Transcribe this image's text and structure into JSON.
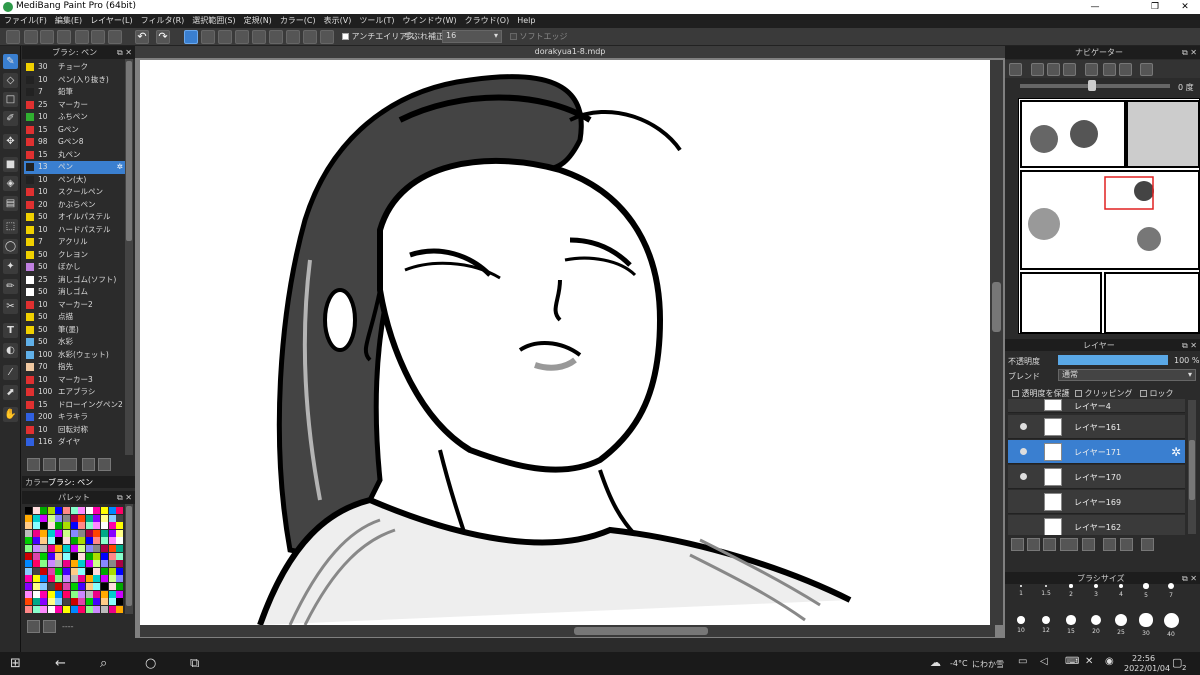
{
  "window": {
    "title": "MediBang Paint Pro (64bit)",
    "minimize": "—",
    "maximize": "❐",
    "close": "✕"
  },
  "menu": [
    "ファイル(F)",
    "編集(E)",
    "レイヤー(L)",
    "フィルタ(R)",
    "選択範囲(S)",
    "定規(N)",
    "カラー(C)",
    "表示(V)",
    "ツール(T)",
    "ウインドウ(W)",
    "クラウド(O)",
    "Help"
  ],
  "toolbar": {
    "antialias_label": "アンチエイリアス",
    "stabilizer_label": "手ぶれ補正",
    "stabilizer_value": "16",
    "soft_edge_label": "ソフトエッジ"
  },
  "brush_panel": {
    "title": "ブラシ: ペン",
    "items": [
      {
        "size": "30",
        "name": "チョーク",
        "color": "#f0d000"
      },
      {
        "size": "10",
        "name": "ペン(入り抜き)",
        "color": "#222222"
      },
      {
        "size": "7",
        "name": "鉛筆",
        "color": "#222222"
      },
      {
        "size": "25",
        "name": "マーカー",
        "color": "#e03030"
      },
      {
        "size": "10",
        "name": "ふちペン",
        "color": "#30b030"
      },
      {
        "size": "15",
        "name": "Gペン",
        "color": "#e03030"
      },
      {
        "size": "98",
        "name": "Gペン8",
        "color": "#e03030"
      },
      {
        "size": "15",
        "name": "丸ペン",
        "color": "#e03030"
      },
      {
        "size": "13",
        "name": "ペン",
        "color": "#222222",
        "selected": true
      },
      {
        "size": "10",
        "name": "ペン(大)",
        "color": "#222222"
      },
      {
        "size": "10",
        "name": "スクールペン",
        "color": "#e03030"
      },
      {
        "size": "20",
        "name": "かぶらペン",
        "color": "#e03030"
      },
      {
        "size": "50",
        "name": "オイルパステル",
        "color": "#f0d000"
      },
      {
        "size": "10",
        "name": "ハードパステル",
        "color": "#f0d000"
      },
      {
        "size": "7",
        "name": "アクリル",
        "color": "#f0d000"
      },
      {
        "size": "50",
        "name": "クレヨン",
        "color": "#f0d000"
      },
      {
        "size": "50",
        "name": "ぼかし",
        "color": "#c080e0"
      },
      {
        "size": "25",
        "name": "消しゴム(ソフト)",
        "color": "#ffffff"
      },
      {
        "size": "50",
        "name": "消しゴム",
        "color": "#ffffff"
      },
      {
        "size": "10",
        "name": "マーカー2",
        "color": "#e03030"
      },
      {
        "size": "50",
        "name": "点描",
        "color": "#f0d000"
      },
      {
        "size": "50",
        "name": "筆(墨)",
        "color": "#f0d000"
      },
      {
        "size": "50",
        "name": "水彩",
        "color": "#60b0e8"
      },
      {
        "size": "100",
        "name": "水彩(ウェット)",
        "color": "#60b0e8"
      },
      {
        "size": "70",
        "name": "指先",
        "color": "#f0c8a0"
      },
      {
        "size": "10",
        "name": "マーカー3",
        "color": "#e03030"
      },
      {
        "size": "100",
        "name": "エアブラシ",
        "color": "#e03030"
      },
      {
        "size": "15",
        "name": "ドローイングペン2",
        "color": "#e03030"
      },
      {
        "size": "200",
        "name": "キラキラ",
        "color": "#3060e0"
      },
      {
        "size": "10",
        "name": "回転対称",
        "color": "#e03030"
      },
      {
        "size": "116",
        "name": "ダイヤ",
        "color": "#3060e0"
      }
    ]
  },
  "lower_tabs": {
    "color": "カラー",
    "brush": "ブラシ: ペン"
  },
  "palette": {
    "title": "パレット",
    "footer_text": "----"
  },
  "document": {
    "title": "dorakyua1-8.mdp"
  },
  "navigator": {
    "title": "ナビゲーター",
    "angle": "0 度"
  },
  "layer_panel": {
    "title": "レイヤー",
    "opacity_label": "不透明度",
    "opacity_value": "100 %",
    "opacity_fraction": 1.0,
    "blend_label": "ブレンド",
    "blend_value": "通常",
    "protect_alpha": "透明度を保護",
    "clipping": "クリッピング",
    "lock": "ロック",
    "layers": [
      {
        "name": "レイヤー4",
        "visible": false,
        "selected": false
      },
      {
        "name": "レイヤー161",
        "visible": true,
        "selected": false
      },
      {
        "name": "レイヤー171",
        "visible": true,
        "selected": true
      },
      {
        "name": "レイヤー170",
        "visible": true,
        "selected": false
      },
      {
        "name": "レイヤー169",
        "visible": false,
        "selected": false
      },
      {
        "name": "レイヤー162",
        "visible": false,
        "selected": false
      }
    ]
  },
  "brush_size": {
    "title": "ブラシサイズ",
    "sizes": [
      "1",
      "1.5",
      "2",
      "3",
      "4",
      "5",
      "7",
      "10",
      "12",
      "15",
      "20",
      "25",
      "30",
      "40"
    ]
  },
  "taskbar": {
    "weather_temp": "-4°C",
    "weather_text": "にわか雪",
    "time": "22:56",
    "date": "2022/01/04",
    "notif_count": "2"
  }
}
